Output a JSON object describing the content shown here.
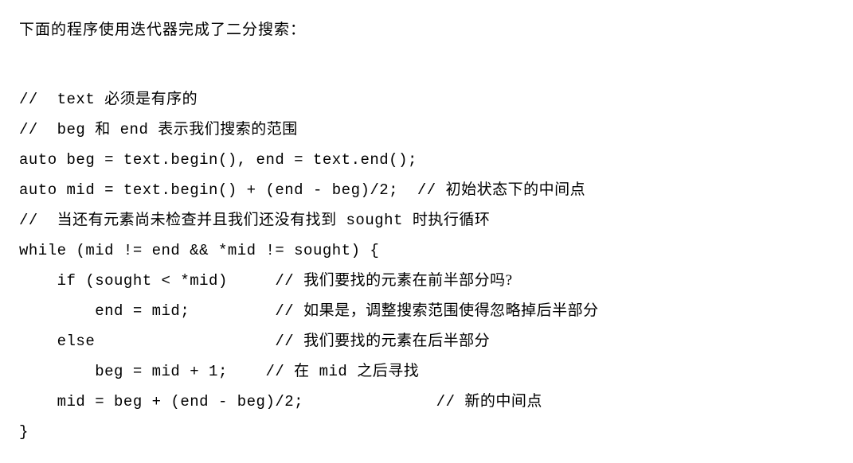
{
  "intro": "下面的程序使用迭代器完成了二分搜索：",
  "code": {
    "l1_pre": "//  text ",
    "l1_cj": "必须是有序的",
    "l2_pre": "//  beg ",
    "l2_cj1": "和",
    "l2_mid": " end ",
    "l2_cj2": "表示我们搜索的范围",
    "l3": "auto beg = text.begin(), end = text.end();",
    "l4_code": "auto mid = text.begin() + (end - beg)/2;  // ",
    "l4_cj": "初始状态下的中间点",
    "l5_pre": "//  ",
    "l5_cj1": "当还有元素尚未检查并且我们还没有找到",
    "l5_mid": " sought ",
    "l5_cj2": "时执行循环",
    "l6": "while (mid != end && *mid != sought) {",
    "l7_code": "    if (sought < *mid)     // ",
    "l7_cj": "我们要找的元素在前半部分吗?",
    "l8_code": "        end = mid;         // ",
    "l8_cj": "如果是，调整搜索范围使得忽略掉后半部分",
    "l9_code": "    else                   // ",
    "l9_cj": "我们要找的元素在后半部分",
    "l10_code": "        beg = mid + 1;    // ",
    "l10_cj1": "在",
    "l10_mid": " mid ",
    "l10_cj2": "之后寻找",
    "l11_code": "    mid = beg + (end - beg)/2;              // ",
    "l11_cj": "新的中间点",
    "l12": "}"
  }
}
